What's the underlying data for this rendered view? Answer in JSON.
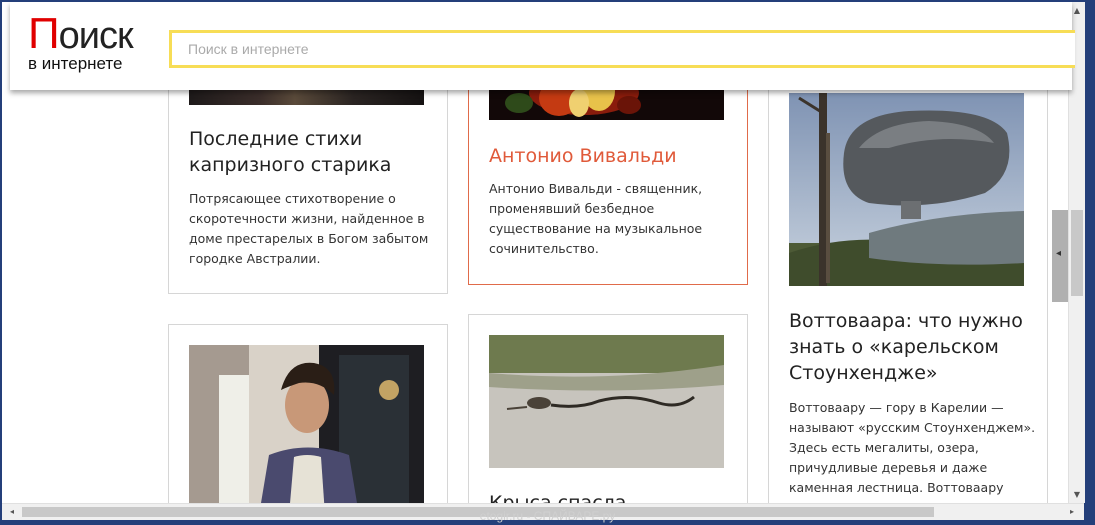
{
  "header": {
    "logo_main": "Поиск",
    "logo_sub": "в интернете",
    "search_placeholder": "Поиск в интернете"
  },
  "cards": [
    {
      "title": "Последние стихи капризного старика",
      "description": "Потрясающее стихотворение о скоротечности жизни, найденное в доме престарелых в Богом забытом городке Австралии."
    },
    {
      "title": "Антонио Вивальди",
      "description": "Антонио Вивальди - священник, променявший безбедное существование на музыкальное сочинительство."
    },
    {
      "title": "Воттоваара: что нужно знать о «карельском Стоунхендже»",
      "description": "Воттоваару — гору в Карелии — называют «русским Стоунхенджем». Здесь есть мегалиты, озера, причудливые деревья и даже каменная лестница. Воттоваару"
    },
    {
      "title": "",
      "description": ""
    },
    {
      "title": "Крыса спасла",
      "description": ""
    }
  ],
  "watermark": "etogir.ru - СПАЙВАРЕ.ру"
}
